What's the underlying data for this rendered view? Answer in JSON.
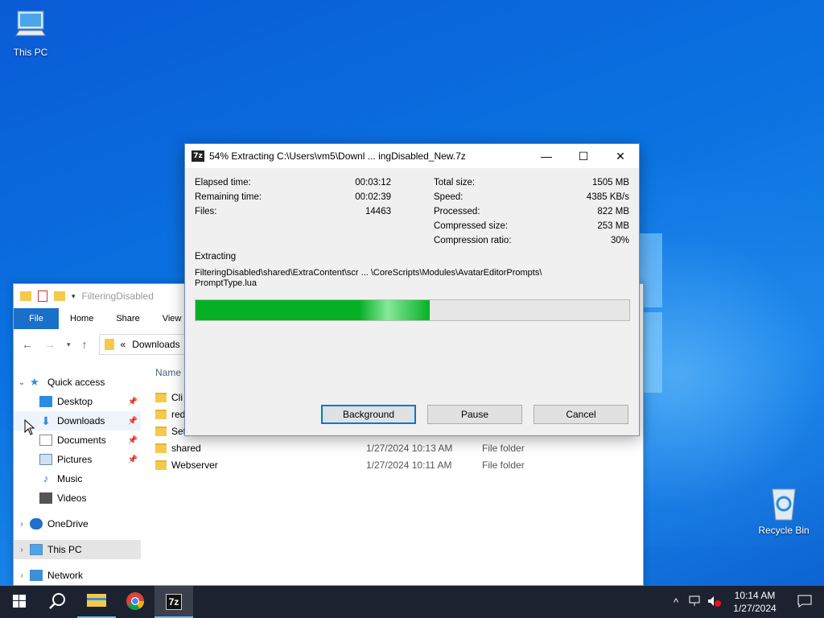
{
  "desktop": {
    "this_pc_label": "This PC",
    "recycle_bin_label": "Recycle Bin"
  },
  "explorer": {
    "title": "FilteringDisabled",
    "ribbon_tabs": [
      "File",
      "Home",
      "Share",
      "View"
    ],
    "address_breadcrumb_sep": "«",
    "address_location": "Downloads",
    "column_name": "Name",
    "nav": {
      "quick_access": "Quick access",
      "desktop": "Desktop",
      "downloads": "Downloads",
      "documents": "Documents",
      "pictures": "Pictures",
      "music": "Music",
      "videos": "Videos",
      "onedrive": "OneDrive",
      "this_pc": "This PC",
      "network": "Network"
    },
    "files": [
      {
        "name": "Cli",
        "date": "",
        "type": ""
      },
      {
        "name": "red",
        "date": "",
        "type": ""
      },
      {
        "name": "Set",
        "date": "",
        "type": ""
      },
      {
        "name": "shared",
        "date": "1/27/2024 10:13 AM",
        "type": "File folder"
      },
      {
        "name": "Webserver",
        "date": "1/27/2024 10:11 AM",
        "type": "File folder"
      }
    ]
  },
  "dialog": {
    "app_icon_text": "7z",
    "title": "54% Extracting C:\\Users\\vm5\\Downl ... ingDisabled_New.7z",
    "left_stats": [
      {
        "label": "Elapsed time:",
        "value": "00:03:12"
      },
      {
        "label": "Remaining time:",
        "value": "00:02:39"
      },
      {
        "label": "Files:",
        "value": "14463"
      }
    ],
    "right_stats": [
      {
        "label": "Total size:",
        "value": "1505 MB"
      },
      {
        "label": "Speed:",
        "value": "4385 KB/s"
      },
      {
        "label": "Processed:",
        "value": "822 MB"
      },
      {
        "label": "Compressed size:",
        "value": "253 MB"
      },
      {
        "label": "Compression ratio:",
        "value": "30%"
      }
    ],
    "operation": "Extracting",
    "current_path_line1": "FilteringDisabled\\shared\\ExtraContent\\scr ... \\CoreScripts\\Modules\\AvatarEditorPrompts\\",
    "current_path_line2": "PromptType.lua",
    "progress_percent": 54,
    "buttons": {
      "background": "Background",
      "pause": "Pause",
      "cancel": "Cancel"
    },
    "controls": {
      "minimize": "—",
      "maximize": "☐",
      "close": "✕"
    }
  },
  "taskbar": {
    "active_app_text": "7z",
    "clock_time": "10:14 AM",
    "clock_date": "1/27/2024"
  },
  "colors": {
    "progress_green": "#06b025",
    "accent_blue": "#0078d7",
    "taskbar_bg": "#1c2230"
  }
}
